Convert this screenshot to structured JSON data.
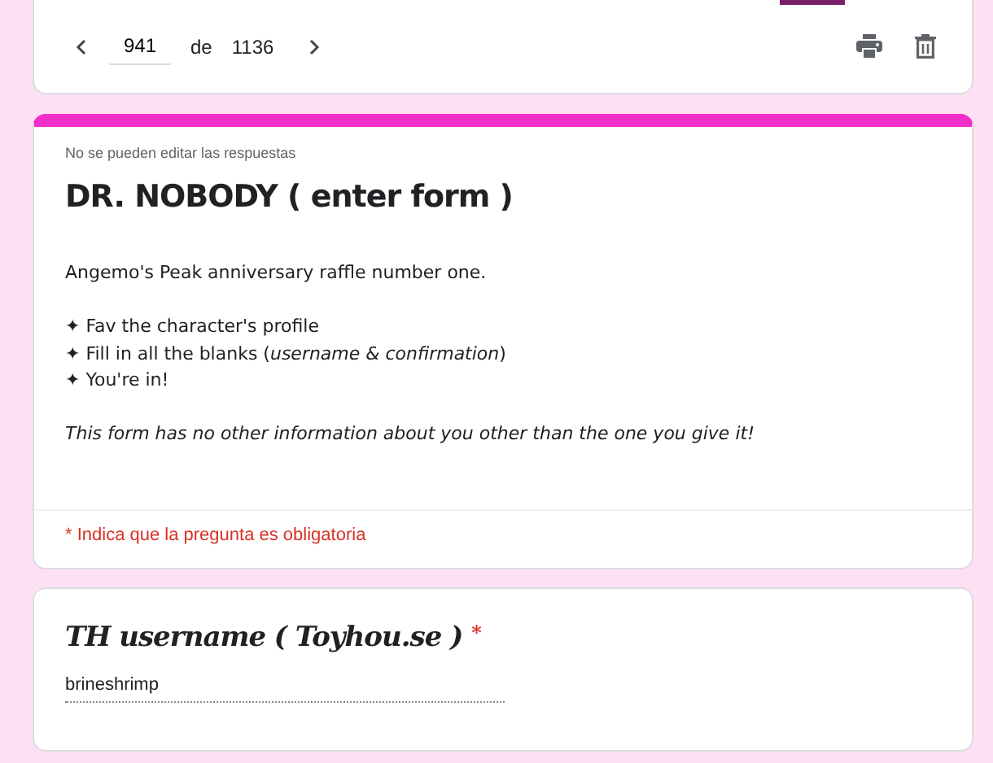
{
  "pager": {
    "current": "941",
    "separator": "de",
    "total": "1136"
  },
  "form": {
    "notice": "No se pueden editar las respuestas",
    "title": "DR. NOBODY ( enter form )",
    "description": [
      [
        "Angemo's Peak anniversary raffle number one."
      ],
      [
        "✦ Fav the character's profile",
        "✦ Fill in all the blanks (*username & confirmation*)",
        "✦ You're in!"
      ],
      [
        "*This form has no other information about you other than the one you give it!*"
      ]
    ],
    "required_note": "* Indica que la pregunta es obligatoria"
  },
  "question": {
    "title": "TH username ( Toyhou.se )",
    "required_mark": "*",
    "value": "brineshrimp"
  }
}
